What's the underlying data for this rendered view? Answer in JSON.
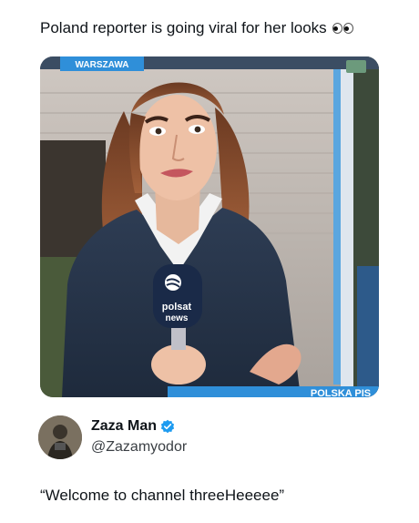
{
  "post": {
    "caption": "Poland  reporter is going viral for her looks",
    "caption_emoji_icon": "eyes-emoji-icon"
  },
  "media": {
    "location_bug": "WARSZAWA",
    "mic_brand_line1": "polsat",
    "mic_brand_line2": "news",
    "ticker_text": "POLSKA PIS",
    "accent_blue": "#2f8fd9"
  },
  "author": {
    "display_name": "Zaza Man",
    "handle": "@Zazamyodor",
    "verified": true,
    "verified_color": "#1d9bf0"
  },
  "reply": {
    "text": "“Welcome to channel threeHeeeee”"
  }
}
